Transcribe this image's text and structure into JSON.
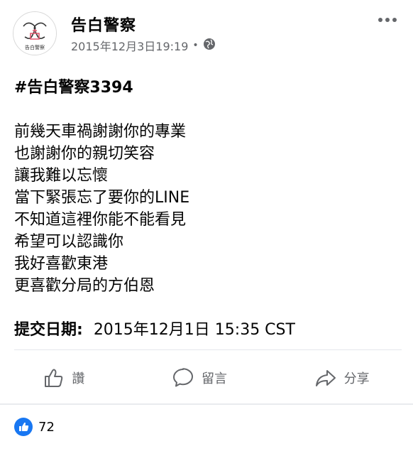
{
  "post": {
    "page_name": "告白警察",
    "timestamp": "2015年12月3日19:19",
    "separator": "•",
    "avatar": {
      "logo_text": "告白警察",
      "icon": "confession-police-logo"
    },
    "body_lines": [
      "#告白警察3394",
      "",
      "前幾天車禍謝謝你的專業",
      "也謝謝你的親切笑容",
      "讓我難以忘懷",
      "當下緊張忘了要你的LINE",
      "不知道這裡你能不能看見",
      "希望可以認識你",
      "我好喜歡東港",
      "更喜歡分局的方伯恩",
      ""
    ],
    "submit": {
      "label": "提交日期:",
      "value": "2015年12月1日 15:35 CST"
    }
  },
  "actions": {
    "like_label": "讚",
    "comment_label": "留言",
    "share_label": "分享"
  },
  "reactions": {
    "count": "72"
  },
  "colors": {
    "brand_blue": "#1877f2",
    "secondary_text": "#65676b",
    "primary_text": "#050505",
    "divider": "#e4e6eb"
  }
}
